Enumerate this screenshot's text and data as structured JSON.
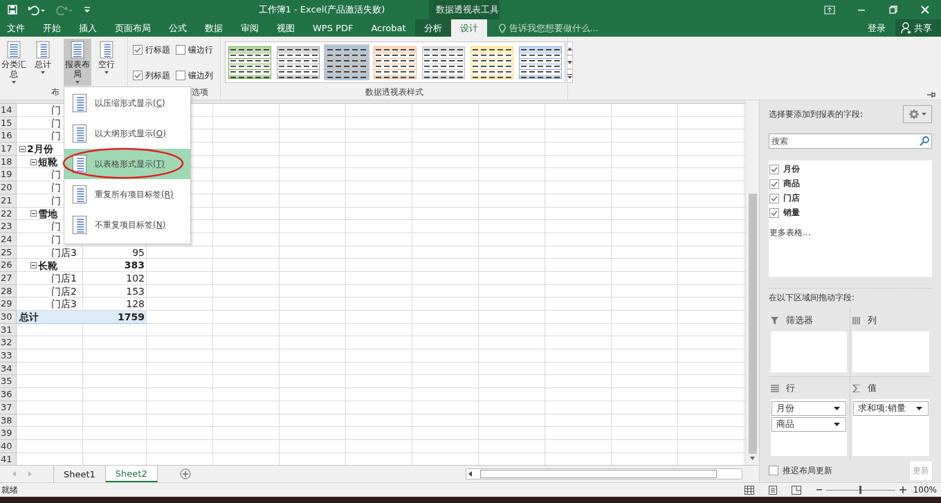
{
  "title_bar": {
    "title": "工作簿1 - Excel(产品激活失败)",
    "context_title": "数据透视表工具"
  },
  "ribbon_tabs": [
    {
      "label": "文件",
      "selected": false,
      "kind": "normal"
    },
    {
      "label": "开始",
      "selected": false,
      "kind": "normal"
    },
    {
      "label": "插入",
      "selected": false,
      "kind": "normal"
    },
    {
      "label": "页面布局",
      "selected": false,
      "kind": "normal"
    },
    {
      "label": "公式",
      "selected": false,
      "kind": "normal"
    },
    {
      "label": "数据",
      "selected": false,
      "kind": "normal"
    },
    {
      "label": "审阅",
      "selected": false,
      "kind": "normal"
    },
    {
      "label": "视图",
      "selected": false,
      "kind": "normal"
    },
    {
      "label": "WPS PDF",
      "selected": false,
      "kind": "normal"
    },
    {
      "label": "Acrobat",
      "selected": false,
      "kind": "normal"
    },
    {
      "label": "分析",
      "selected": false,
      "kind": "context"
    },
    {
      "label": "设计",
      "selected": true,
      "kind": "context"
    }
  ],
  "tell_me": {
    "placeholder": "告诉我您想要做什么..."
  },
  "sign_in": "登录",
  "share": "共享",
  "ribbon": {
    "layout_buttons": [
      {
        "label": "分类汇总",
        "pressed": false
      },
      {
        "label": "总计",
        "pressed": false
      },
      {
        "label": "报表布局",
        "pressed": true
      },
      {
        "label": "空行",
        "pressed": false
      }
    ],
    "layout_group": "布",
    "options": [
      {
        "label": "行标题",
        "checked": true
      },
      {
        "label": "镶边行",
        "checked": false
      },
      {
        "label": "列标题",
        "checked": true
      },
      {
        "label": "镶边列",
        "checked": false
      }
    ],
    "options_group": "选项",
    "styles": [
      {
        "color": "#70ad47",
        "selected": false
      },
      {
        "color": "#a5a5a5",
        "selected": false
      },
      {
        "color": "#9dc3e6",
        "selected": true
      },
      {
        "color": "#f4b183",
        "selected": false
      },
      {
        "color": "#bfbfbf",
        "selected": false
      },
      {
        "color": "#ffd966",
        "selected": false
      },
      {
        "color": "#8faadc",
        "selected": false
      }
    ],
    "styles_group": "数据透视表样式"
  },
  "sheet": {
    "rows": [
      {
        "num": "14",
        "kind": "store",
        "a": "门"
      },
      {
        "num": "15",
        "kind": "store",
        "a": "门"
      },
      {
        "num": "16",
        "kind": "store",
        "a": "门"
      },
      {
        "num": "17",
        "kind": "month",
        "a": "2月份"
      },
      {
        "num": "18",
        "kind": "product",
        "a": "短靴"
      },
      {
        "num": "19",
        "kind": "store",
        "a": "门"
      },
      {
        "num": "20",
        "kind": "store",
        "a": "门"
      },
      {
        "num": "21",
        "kind": "store",
        "a": "门"
      },
      {
        "num": "22",
        "kind": "product",
        "a": "雪地"
      },
      {
        "num": "23",
        "kind": "store",
        "a": "门"
      },
      {
        "num": "24",
        "kind": "store",
        "a": "门"
      },
      {
        "num": "25",
        "kind": "store",
        "a": "门店3",
        "b": "95"
      },
      {
        "num": "26",
        "kind": "product",
        "a": "长靴",
        "b": "383"
      },
      {
        "num": "27",
        "kind": "store",
        "a": "门店1",
        "b": "102"
      },
      {
        "num": "28",
        "kind": "store",
        "a": "门店2",
        "b": "153"
      },
      {
        "num": "29",
        "kind": "store",
        "a": "门店3",
        "b": "128"
      },
      {
        "num": "30",
        "kind": "total",
        "a": "总计",
        "b": "1759"
      },
      {
        "num": "31"
      },
      {
        "num": "32"
      },
      {
        "num": "33"
      },
      {
        "num": "34"
      },
      {
        "num": "35"
      },
      {
        "num": "36"
      },
      {
        "num": "37"
      },
      {
        "num": "38"
      },
      {
        "num": "39"
      },
      {
        "num": "40"
      },
      {
        "num": "41"
      }
    ]
  },
  "layout_menu": {
    "items": [
      {
        "label": "以压缩形式显示",
        "accelerator": "(C)",
        "selected": false
      },
      {
        "label": "以大纲形式显示",
        "accelerator": "(O)",
        "selected": false
      },
      {
        "label": "以表格形式显示",
        "accelerator": "(T)",
        "selected": true
      },
      {
        "label": "重复所有项目标签",
        "accelerator": "(R)",
        "selected": false
      },
      {
        "label": "不重复项目标签",
        "accelerator": "(N)",
        "selected": false
      }
    ]
  },
  "field_pane": {
    "heading": "选择要添加到报表的字段:",
    "search": {
      "placeholder": "搜索"
    },
    "fields": [
      {
        "label": "月份",
        "checked": true
      },
      {
        "label": "商品",
        "checked": true
      },
      {
        "label": "门店",
        "checked": true
      },
      {
        "label": "销量",
        "checked": true
      }
    ],
    "more_tables": "更多表格...",
    "areas_heading": "在以下区域间拖动字段:",
    "areas": [
      {
        "kind": "filter",
        "label": "筛选器"
      },
      {
        "kind": "columns",
        "label": "列"
      },
      {
        "kind": "rows",
        "label": "行",
        "items": [
          "月份",
          "商品"
        ]
      },
      {
        "kind": "values",
        "label": "值",
        "items": [
          "求和项:销量"
        ]
      }
    ],
    "defer": {
      "label": "推迟布局更新",
      "checked": false
    },
    "update": {
      "label": "更新",
      "disabled": true
    }
  },
  "sheet_tabs": [
    {
      "label": "Sheet1",
      "selected": false
    },
    {
      "label": "Sheet2",
      "selected": true
    }
  ],
  "status_bar": {
    "text": "就绪",
    "zoom": "100%",
    "zoom_slider": {
      "level": 0.5
    }
  }
}
